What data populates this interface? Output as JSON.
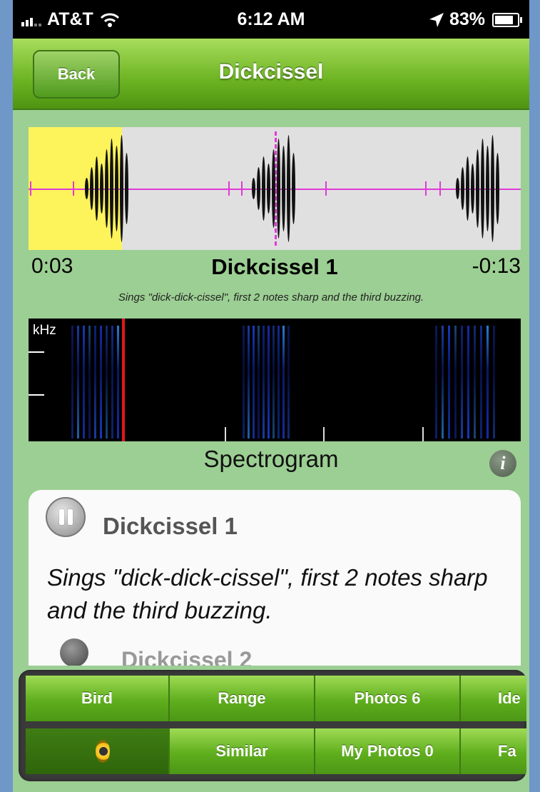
{
  "status_bar": {
    "carrier": "AT&T",
    "time": "6:12 AM",
    "battery": "83%",
    "battery_level": 0.83,
    "icons": [
      "signal-icon",
      "wifi-icon",
      "location-arrow-icon",
      "battery-icon"
    ]
  },
  "nav": {
    "back_label": "Back",
    "title": "Dickcissel"
  },
  "player": {
    "elapsed": "0:03",
    "remaining": "-0:13",
    "recording_title": "Dickcissel 1",
    "caption": "Sings \"dick-dick-cissel\", first 2 notes sharp and the third buzzing.",
    "progress": 0.19
  },
  "spectrogram": {
    "axis_label": "kHz",
    "label": "Spectrogram",
    "info_icon": "i"
  },
  "detail": {
    "title": "Dickcissel 1",
    "description": "Sings \"dick-dick-cissel\", first 2 notes sharp and the third buzzing.",
    "next_item_peek": "Dickcissel 2"
  },
  "tabs": {
    "row1": [
      "Bird",
      "Range",
      "Photos 6",
      "Ide"
    ],
    "row2": [
      "",
      "Similar",
      "My Photos 0",
      "Fa"
    ],
    "active_icon": "speaker-icon"
  },
  "colors": {
    "page_background": "#9ccf93",
    "nav_green": "#6cb322",
    "waveform_highlight": "#fdf35b",
    "waveform_line": "#e03ad6",
    "spectrogram_cursor": "#e0181c",
    "outer_background": "#6f97c8"
  }
}
